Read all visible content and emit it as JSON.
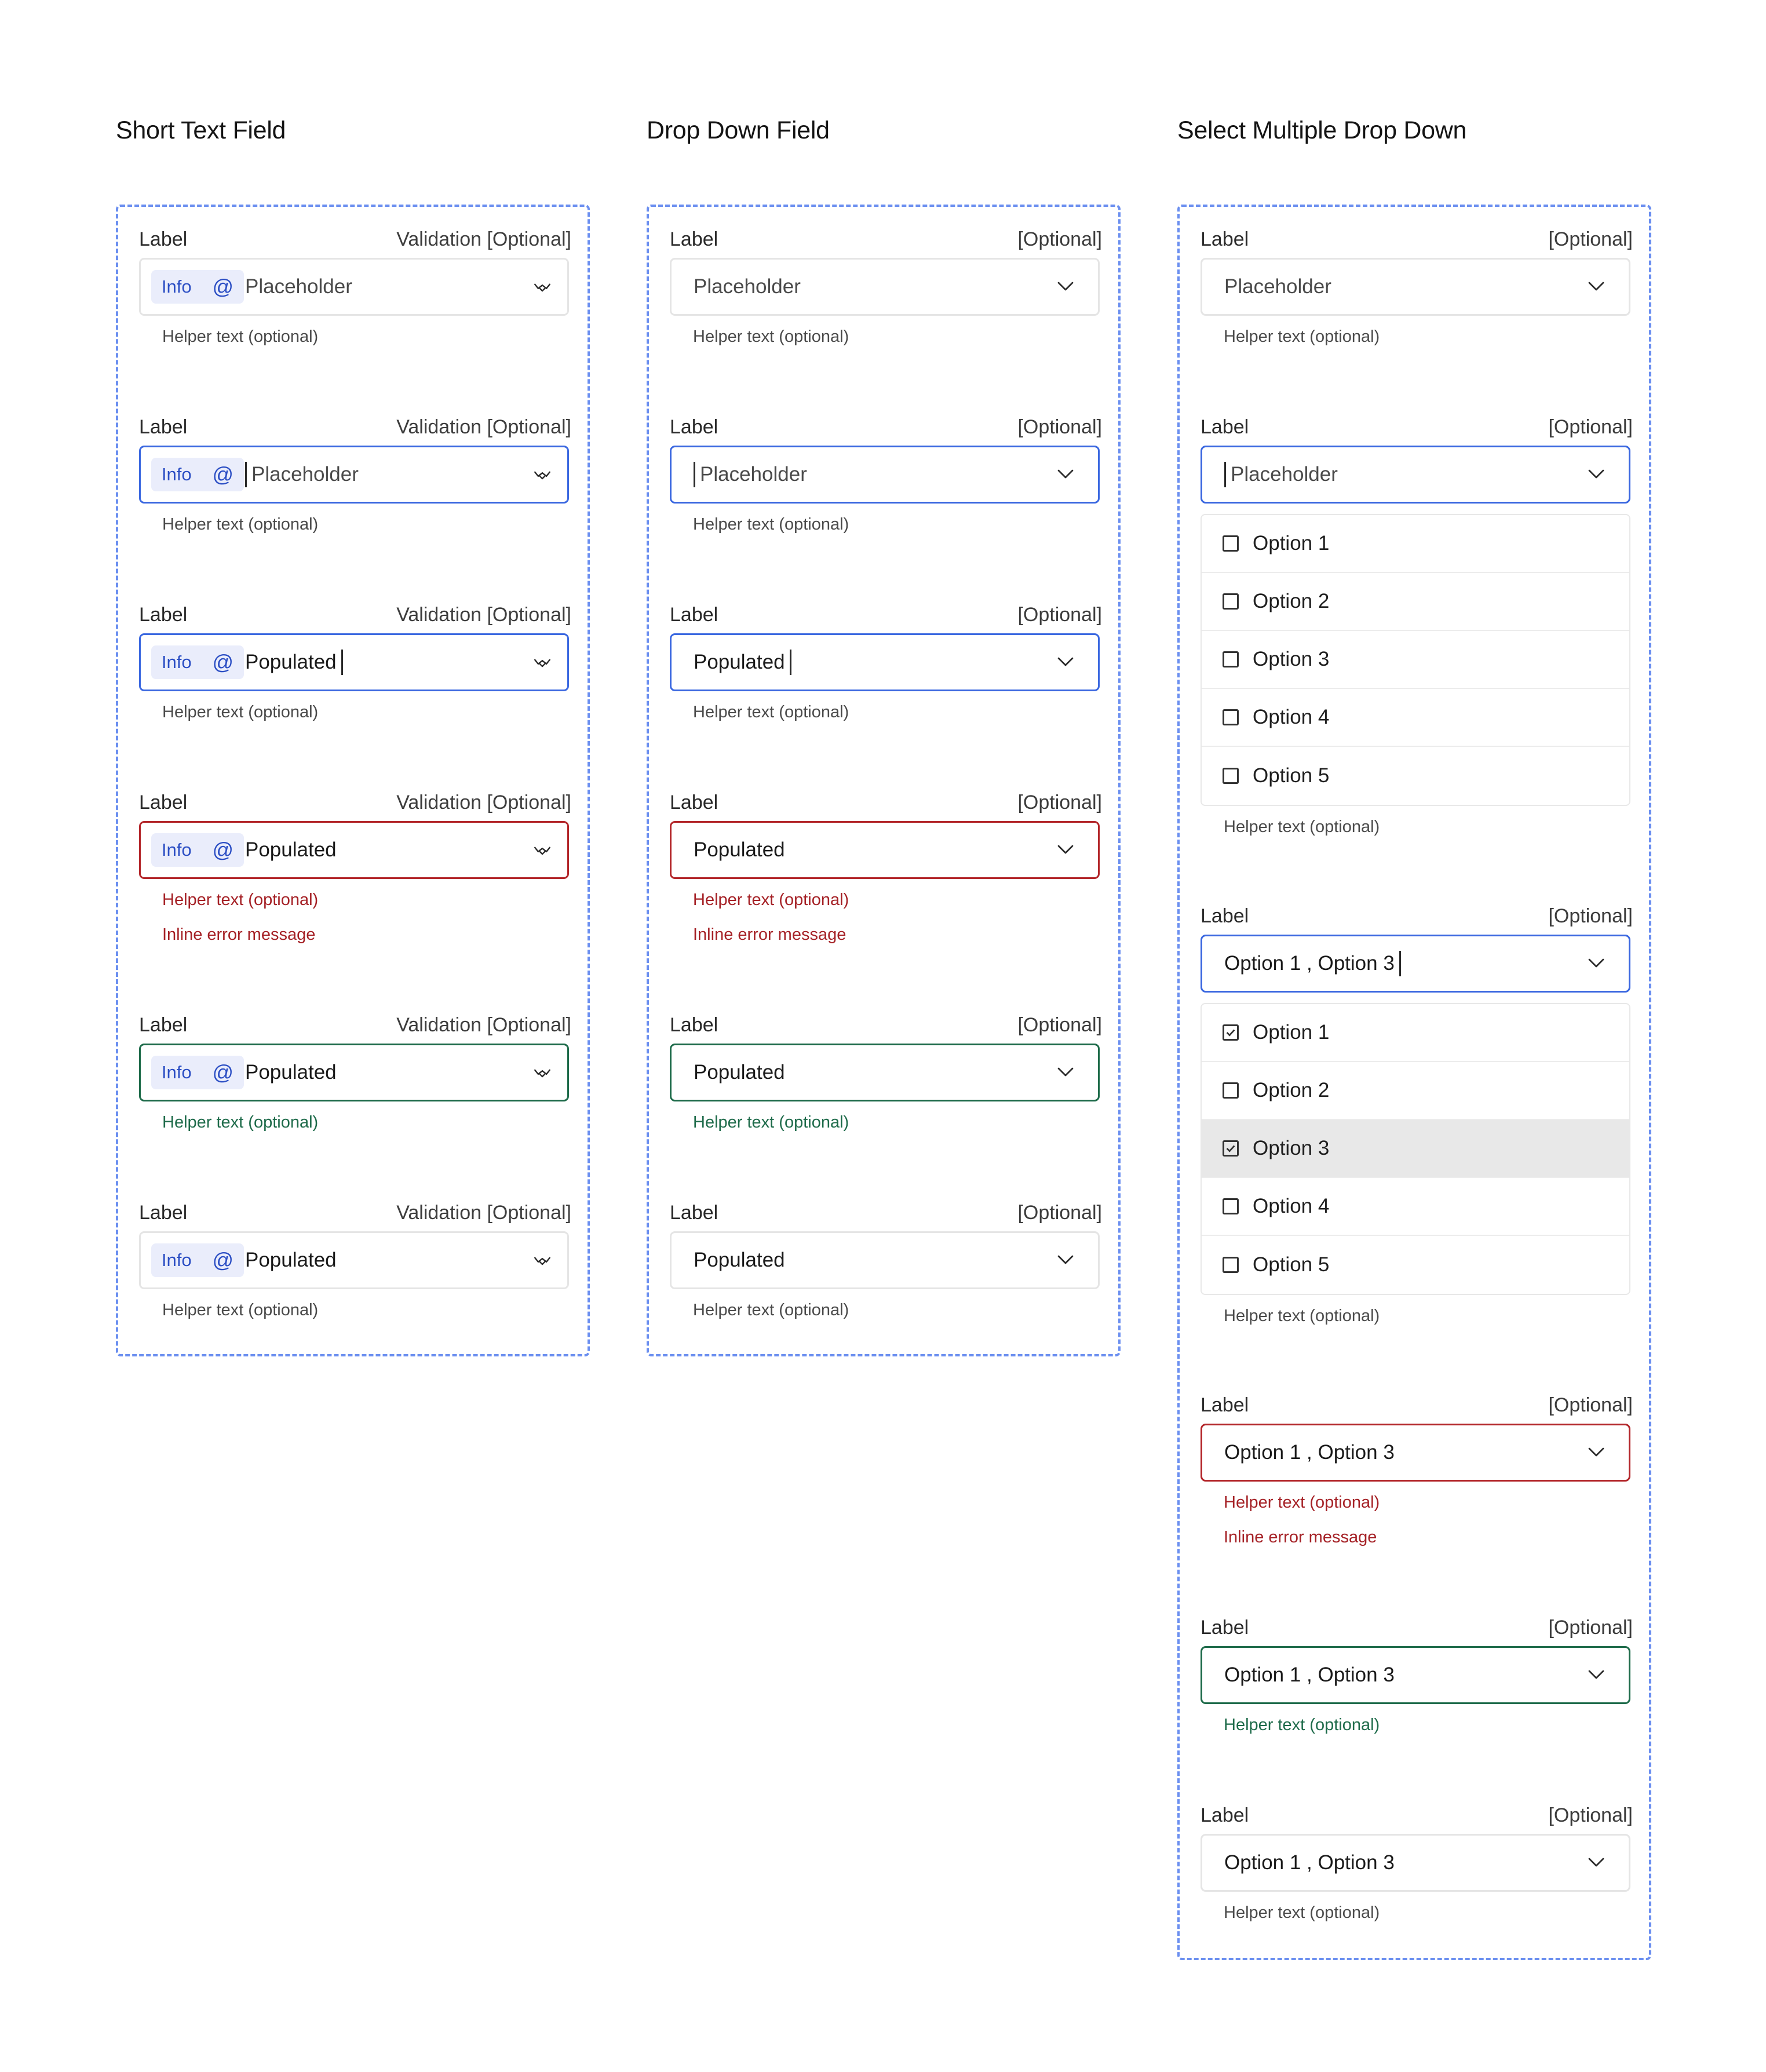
{
  "colors": {
    "dashed_border": "#6b8ff0",
    "focus": "#3b68e0",
    "error": "#b3262a",
    "success": "#1e6b4a",
    "chip_bg": "#eaedfb",
    "chip_text": "#2b4ec4",
    "highlight_row": "#e8e8e8"
  },
  "common": {
    "label": "Label",
    "validation_optional": "Validation [Optional]",
    "optional": "[Optional]",
    "helper": "Helper text (optional)",
    "inline_error": "Inline error message",
    "chip_info": "Info",
    "chip_at": "@",
    "placeholder": "Placeholder",
    "populated": "Populated",
    "text_icon": "glyph-icon",
    "dropdown_icon": "chevron-down-icon"
  },
  "short_text": {
    "title": "Short Text Field",
    "states": [
      "default",
      "focus-empty",
      "focus-typing",
      "error",
      "success",
      "filled"
    ]
  },
  "dropdown": {
    "title": "Drop Down Field",
    "states": [
      "default",
      "focus-empty",
      "focus-typing",
      "error",
      "success",
      "filled"
    ]
  },
  "multi": {
    "title": "Select Multiple Drop Down",
    "options": [
      {
        "label": "Option 1",
        "checked_in_open_2": true
      },
      {
        "label": "Option 2",
        "checked_in_open_2": false
      },
      {
        "label": "Option 3",
        "checked_in_open_2": true
      },
      {
        "label": "Option 4",
        "checked_in_open_2": false
      },
      {
        "label": "Option 5",
        "checked_in_open_2": false
      }
    ],
    "selected_typing": "Option 1 , Option 3",
    "selected": "Option 1  ,  Option 3"
  }
}
